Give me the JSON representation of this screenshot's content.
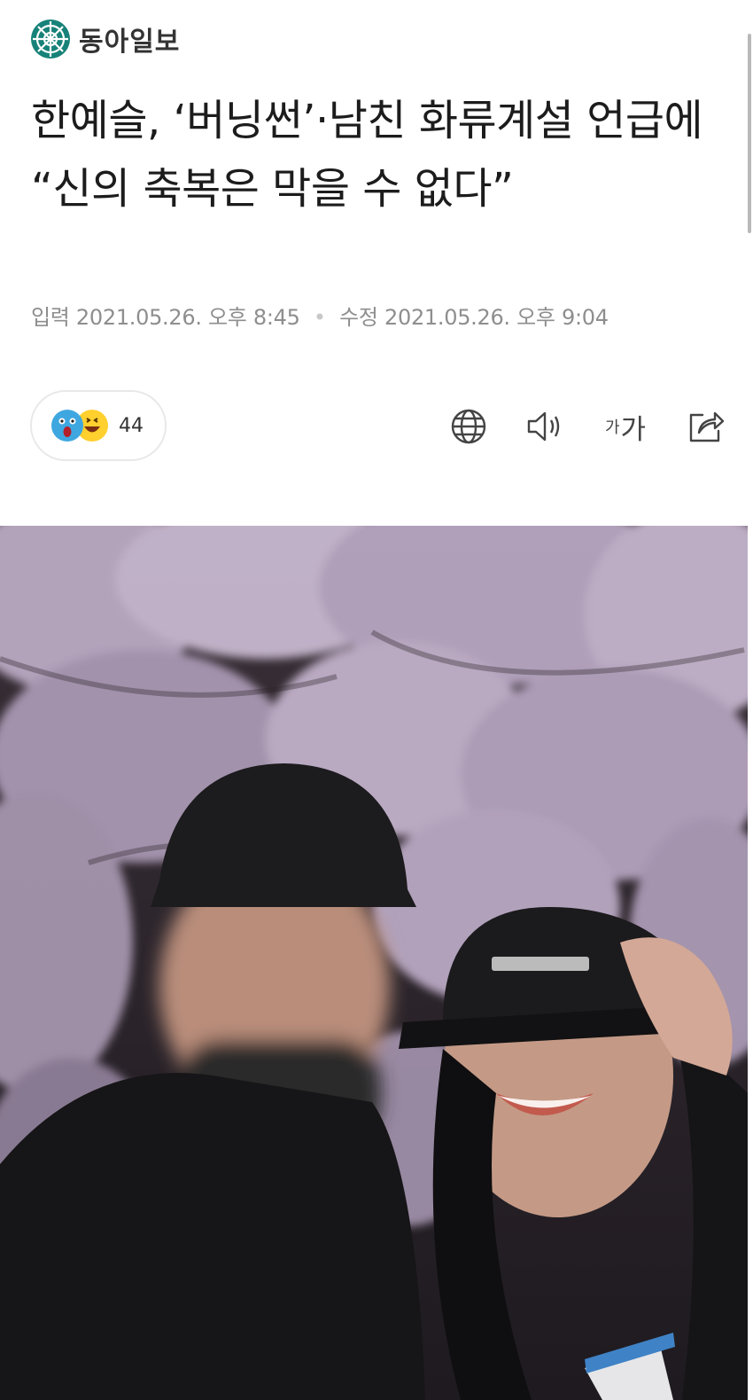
{
  "publication": {
    "name": "동아일보",
    "logo_icon": "donga-emblem-icon",
    "brand_color": "#178279"
  },
  "article": {
    "headline": "한예슬, ‘버닝썬’·남친 화류계설 언급에 “신의 축복은 막을 수 없다”",
    "published_label": "입력",
    "published_time": "2021.05.26. 오후 8:45",
    "modified_label": "수정",
    "modified_time": "2021.05.26. 오후 9:04"
  },
  "reactions": {
    "icons": [
      "surprised-emoji-icon",
      "laughing-emoji-icon"
    ],
    "count": "44"
  },
  "toolbar": {
    "translate_icon": "globe-icon",
    "audio_icon": "speaker-icon",
    "font_size_label_small": "가",
    "font_size_label_large": "가",
    "share_icon": "share-icon"
  },
  "photo": {
    "description_icon": "article-photo"
  }
}
